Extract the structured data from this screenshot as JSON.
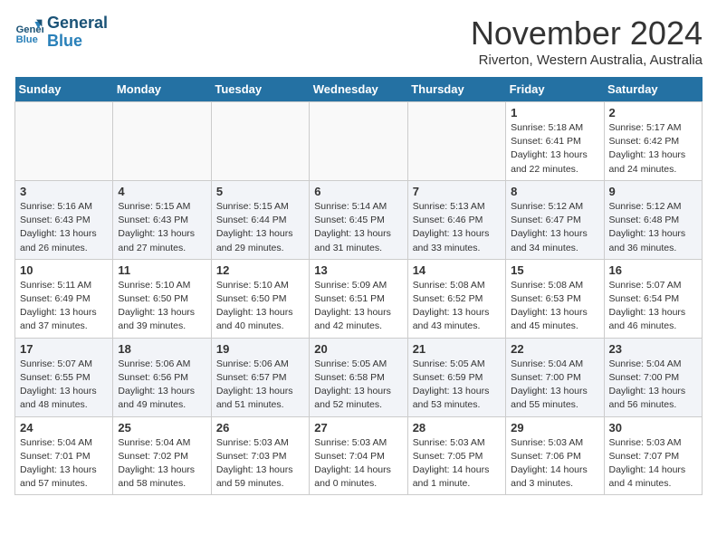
{
  "header": {
    "logo_line1": "General",
    "logo_line2": "Blue",
    "month": "November 2024",
    "location": "Riverton, Western Australia, Australia"
  },
  "weekdays": [
    "Sunday",
    "Monday",
    "Tuesday",
    "Wednesday",
    "Thursday",
    "Friday",
    "Saturday"
  ],
  "weeks": [
    [
      {
        "day": "",
        "info": ""
      },
      {
        "day": "",
        "info": ""
      },
      {
        "day": "",
        "info": ""
      },
      {
        "day": "",
        "info": ""
      },
      {
        "day": "",
        "info": ""
      },
      {
        "day": "1",
        "info": "Sunrise: 5:18 AM\nSunset: 6:41 PM\nDaylight: 13 hours\nand 22 minutes."
      },
      {
        "day": "2",
        "info": "Sunrise: 5:17 AM\nSunset: 6:42 PM\nDaylight: 13 hours\nand 24 minutes."
      }
    ],
    [
      {
        "day": "3",
        "info": "Sunrise: 5:16 AM\nSunset: 6:43 PM\nDaylight: 13 hours\nand 26 minutes."
      },
      {
        "day": "4",
        "info": "Sunrise: 5:15 AM\nSunset: 6:43 PM\nDaylight: 13 hours\nand 27 minutes."
      },
      {
        "day": "5",
        "info": "Sunrise: 5:15 AM\nSunset: 6:44 PM\nDaylight: 13 hours\nand 29 minutes."
      },
      {
        "day": "6",
        "info": "Sunrise: 5:14 AM\nSunset: 6:45 PM\nDaylight: 13 hours\nand 31 minutes."
      },
      {
        "day": "7",
        "info": "Sunrise: 5:13 AM\nSunset: 6:46 PM\nDaylight: 13 hours\nand 33 minutes."
      },
      {
        "day": "8",
        "info": "Sunrise: 5:12 AM\nSunset: 6:47 PM\nDaylight: 13 hours\nand 34 minutes."
      },
      {
        "day": "9",
        "info": "Sunrise: 5:12 AM\nSunset: 6:48 PM\nDaylight: 13 hours\nand 36 minutes."
      }
    ],
    [
      {
        "day": "10",
        "info": "Sunrise: 5:11 AM\nSunset: 6:49 PM\nDaylight: 13 hours\nand 37 minutes."
      },
      {
        "day": "11",
        "info": "Sunrise: 5:10 AM\nSunset: 6:50 PM\nDaylight: 13 hours\nand 39 minutes."
      },
      {
        "day": "12",
        "info": "Sunrise: 5:10 AM\nSunset: 6:50 PM\nDaylight: 13 hours\nand 40 minutes."
      },
      {
        "day": "13",
        "info": "Sunrise: 5:09 AM\nSunset: 6:51 PM\nDaylight: 13 hours\nand 42 minutes."
      },
      {
        "day": "14",
        "info": "Sunrise: 5:08 AM\nSunset: 6:52 PM\nDaylight: 13 hours\nand 43 minutes."
      },
      {
        "day": "15",
        "info": "Sunrise: 5:08 AM\nSunset: 6:53 PM\nDaylight: 13 hours\nand 45 minutes."
      },
      {
        "day": "16",
        "info": "Sunrise: 5:07 AM\nSunset: 6:54 PM\nDaylight: 13 hours\nand 46 minutes."
      }
    ],
    [
      {
        "day": "17",
        "info": "Sunrise: 5:07 AM\nSunset: 6:55 PM\nDaylight: 13 hours\nand 48 minutes."
      },
      {
        "day": "18",
        "info": "Sunrise: 5:06 AM\nSunset: 6:56 PM\nDaylight: 13 hours\nand 49 minutes."
      },
      {
        "day": "19",
        "info": "Sunrise: 5:06 AM\nSunset: 6:57 PM\nDaylight: 13 hours\nand 51 minutes."
      },
      {
        "day": "20",
        "info": "Sunrise: 5:05 AM\nSunset: 6:58 PM\nDaylight: 13 hours\nand 52 minutes."
      },
      {
        "day": "21",
        "info": "Sunrise: 5:05 AM\nSunset: 6:59 PM\nDaylight: 13 hours\nand 53 minutes."
      },
      {
        "day": "22",
        "info": "Sunrise: 5:04 AM\nSunset: 7:00 PM\nDaylight: 13 hours\nand 55 minutes."
      },
      {
        "day": "23",
        "info": "Sunrise: 5:04 AM\nSunset: 7:00 PM\nDaylight: 13 hours\nand 56 minutes."
      }
    ],
    [
      {
        "day": "24",
        "info": "Sunrise: 5:04 AM\nSunset: 7:01 PM\nDaylight: 13 hours\nand 57 minutes."
      },
      {
        "day": "25",
        "info": "Sunrise: 5:04 AM\nSunset: 7:02 PM\nDaylight: 13 hours\nand 58 minutes."
      },
      {
        "day": "26",
        "info": "Sunrise: 5:03 AM\nSunset: 7:03 PM\nDaylight: 13 hours\nand 59 minutes."
      },
      {
        "day": "27",
        "info": "Sunrise: 5:03 AM\nSunset: 7:04 PM\nDaylight: 14 hours\nand 0 minutes."
      },
      {
        "day": "28",
        "info": "Sunrise: 5:03 AM\nSunset: 7:05 PM\nDaylight: 14 hours\nand 1 minute."
      },
      {
        "day": "29",
        "info": "Sunrise: 5:03 AM\nSunset: 7:06 PM\nDaylight: 14 hours\nand 3 minutes."
      },
      {
        "day": "30",
        "info": "Sunrise: 5:03 AM\nSunset: 7:07 PM\nDaylight: 14 hours\nand 4 minutes."
      }
    ]
  ]
}
